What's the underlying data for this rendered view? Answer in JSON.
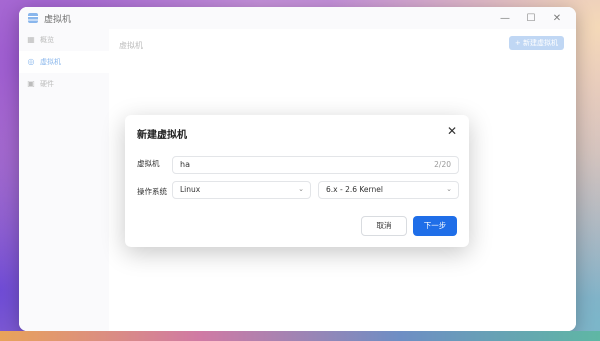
{
  "window": {
    "title": "虚拟机",
    "controls": [
      "—",
      "☐",
      "✕"
    ]
  },
  "sidebar": {
    "items": [
      {
        "label": "概览",
        "icon": "grid-icon",
        "active": false
      },
      {
        "label": "虚拟机",
        "icon": "vm-icon",
        "active": true
      },
      {
        "label": "硬件",
        "icon": "hardware-icon",
        "active": false
      }
    ]
  },
  "main": {
    "title": "虚拟机",
    "new_button": "+ 新建虚拟机"
  },
  "dialog": {
    "title": "新建虚拟机",
    "close": "✕",
    "name_label": "虚拟机",
    "name_value": "ha",
    "name_count": "2/20",
    "os_label": "操作系统",
    "os_select": "Linux",
    "kernel_select": "6.x - 2.6 Kernel",
    "chevron": "⌄",
    "cancel_label": "取消",
    "next_label": "下一步"
  },
  "colors": {
    "accent": "#1f6ee8",
    "accent_light": "#9fc2ef",
    "sidebar_bg": "#f7f8fa"
  }
}
